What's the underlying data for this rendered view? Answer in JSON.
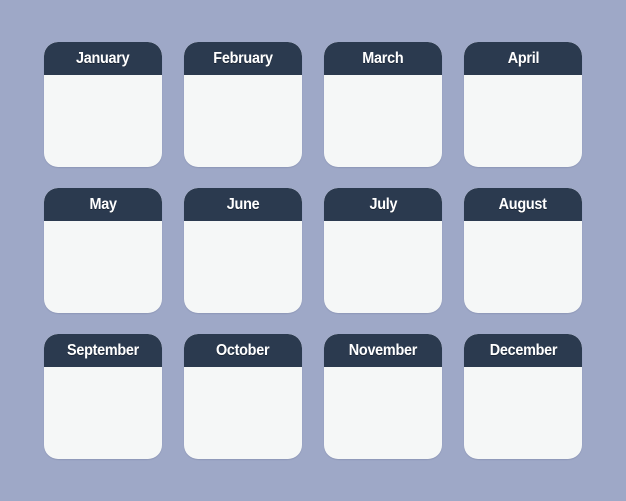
{
  "months": [
    {
      "label": "January"
    },
    {
      "label": "February"
    },
    {
      "label": "March"
    },
    {
      "label": "April"
    },
    {
      "label": "May"
    },
    {
      "label": "June"
    },
    {
      "label": "July"
    },
    {
      "label": "August"
    },
    {
      "label": "September"
    },
    {
      "label": "October"
    },
    {
      "label": "November"
    },
    {
      "label": "December"
    }
  ],
  "colors": {
    "background": "#9ea8c7",
    "header": "#2b3a4f",
    "card": "#f5f7f7",
    "title_text": "#ffffff"
  }
}
